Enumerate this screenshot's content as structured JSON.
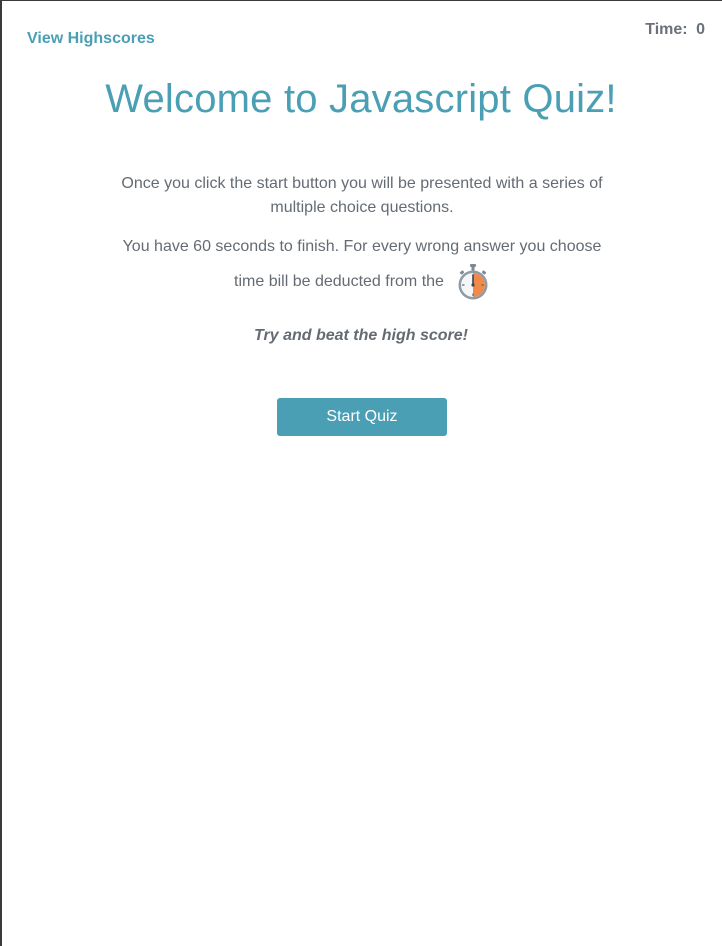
{
  "header": {
    "highscores_link": "View Highscores",
    "timer_label": "Time:",
    "timer_value": "0"
  },
  "main": {
    "title": "Welcome to Javascript Quiz!",
    "intro_paragraph_1": "Once you click the start button you will be presented with a series of multiple choice questions.",
    "intro_paragraph_2_line_1": "You have 60 seconds to finish. For every wrong answer you choose",
    "intro_paragraph_2_line_2": "time bill be deducted from the",
    "stopwatch_icon": "stopwatch-icon",
    "tagline": "Try and beat the high score!",
    "start_button_label": "Start Quiz"
  },
  "colors": {
    "accent": "#4a9fb5",
    "text": "#646b73",
    "stopwatch_orange": "#f08a4b"
  }
}
